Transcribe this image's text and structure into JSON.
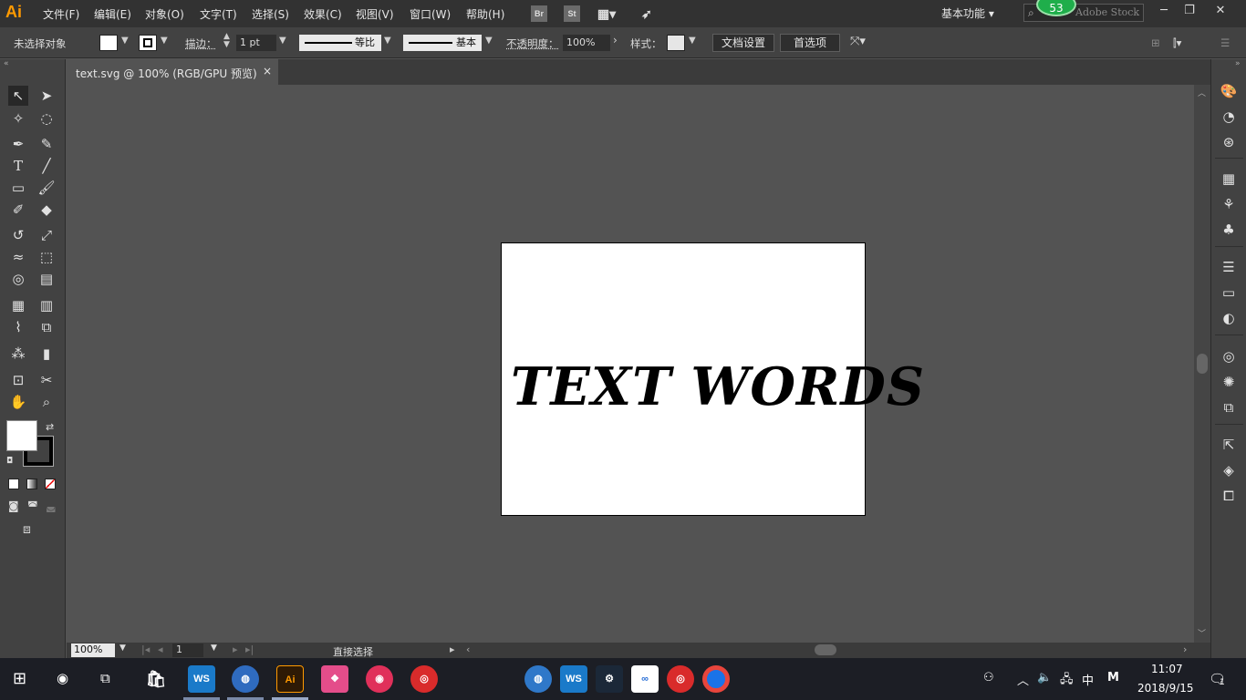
{
  "app": {
    "logo": "Ai",
    "menu": [
      "文件(F)",
      "编辑(E)",
      "对象(O)",
      "文字(T)",
      "选择(S)",
      "效果(C)",
      "视图(V)",
      "窗口(W)",
      "帮助(H)"
    ],
    "bridge": "Br",
    "stock": "St"
  },
  "header": {
    "workspace": "基本功能",
    "search_placeholder": "Adobe Stock",
    "badge": "53"
  },
  "control": {
    "no_selection": "未选择对象",
    "stroke_label": "描边：",
    "stroke_weight": "1 pt",
    "profile_uniform": "等比",
    "brush_basic": "基本",
    "opacity_label": "不透明度：",
    "opacity_value": "100%",
    "style_label": "样式：",
    "doc_setup": "文档设置",
    "preferences": "首选项"
  },
  "document": {
    "tab_title": "text.svg @ 100% (RGB/GPU 预览)",
    "close": "×",
    "artboard_text": "TEXT WORDS"
  },
  "status": {
    "zoom": "100%",
    "artboard_number": "1",
    "current_tool": "直接选择"
  },
  "taskbar": {
    "time": "11:07",
    "date": "2018/9/15",
    "ime": "中",
    "ime2": "M",
    "notif_count": "1"
  },
  "colors": {
    "accent": "#ff9a00",
    "panel": "#424242",
    "canvas": "#535353",
    "badge": "#1fae4b"
  }
}
